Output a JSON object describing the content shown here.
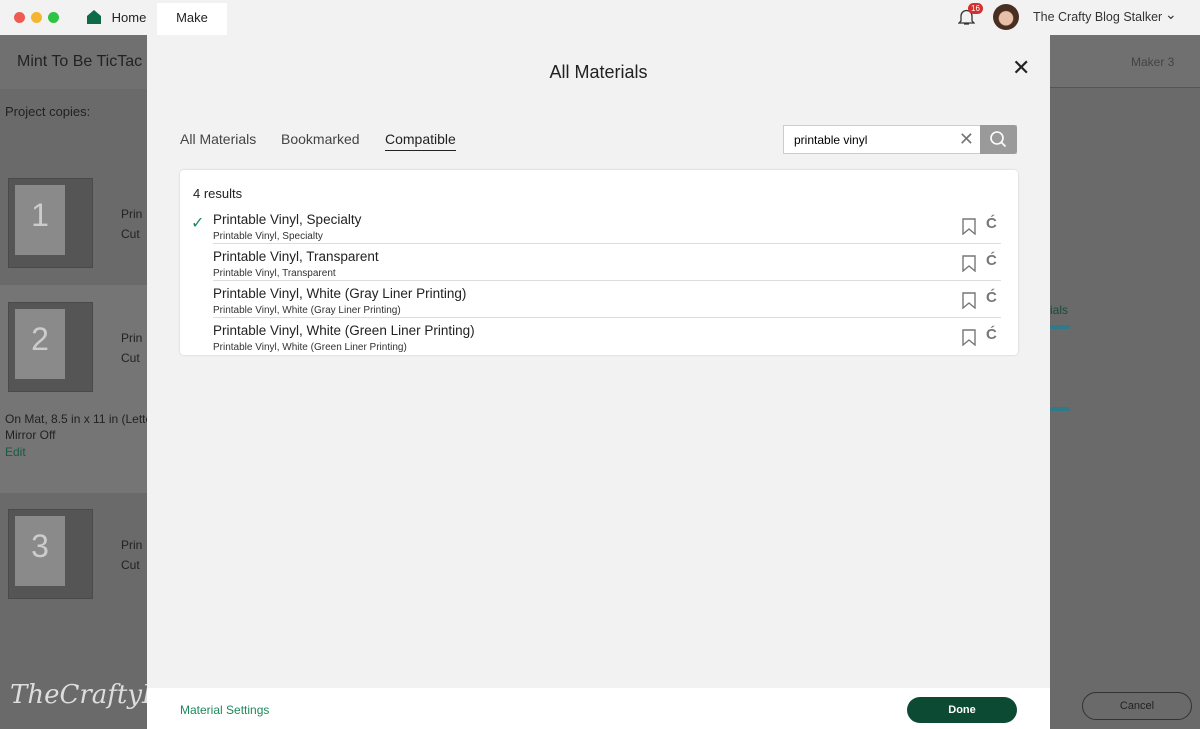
{
  "topbar": {
    "home": "Home",
    "make": "Make",
    "notifications": "16",
    "user": "The Crafty Blog Stalker"
  },
  "background": {
    "project_title": "Mint To Be TicTac",
    "project_copies": "Project copies:",
    "machine": "Maker 3",
    "mats": [
      {
        "num": "1",
        "l1": "Prin",
        "l2": "Cut"
      },
      {
        "num": "2",
        "l1": "Prin",
        "l2": "Cut"
      },
      {
        "num": "3",
        "l1": "Prin",
        "l2": "Cut"
      }
    ],
    "mat_info": "On Mat, 8.5 in x 11 in (Lette",
    "mirror": "Mirror Off",
    "edit": "Edit",
    "materials_link": "ials",
    "watermark": "TheCraftyB",
    "cancel": "Cancel"
  },
  "modal": {
    "title": "All Materials",
    "tabs": [
      {
        "label": "All Materials"
      },
      {
        "label": "Bookmarked"
      },
      {
        "label": "Compatible",
        "active": true
      }
    ],
    "search": {
      "value": "printable vinyl"
    },
    "results_count": "4 results",
    "results": [
      {
        "name": "Printable Vinyl, Specialty",
        "sub": "Printable Vinyl, Specialty",
        "selected": true
      },
      {
        "name": "Printable Vinyl, Transparent",
        "sub": "Printable Vinyl, Transparent"
      },
      {
        "name": "Printable Vinyl, White (Gray Liner Printing)",
        "sub": "Printable Vinyl, White (Gray Liner Printing)"
      },
      {
        "name": "Printable Vinyl, White (Green Liner Printing)",
        "sub": "Printable Vinyl, White (Green Liner Printing)"
      }
    ],
    "material_settings": "Material Settings",
    "done": "Done"
  },
  "colors": {
    "accent": "#0d4a33",
    "link": "#1b8a5a",
    "badge": "#d32f2f"
  }
}
